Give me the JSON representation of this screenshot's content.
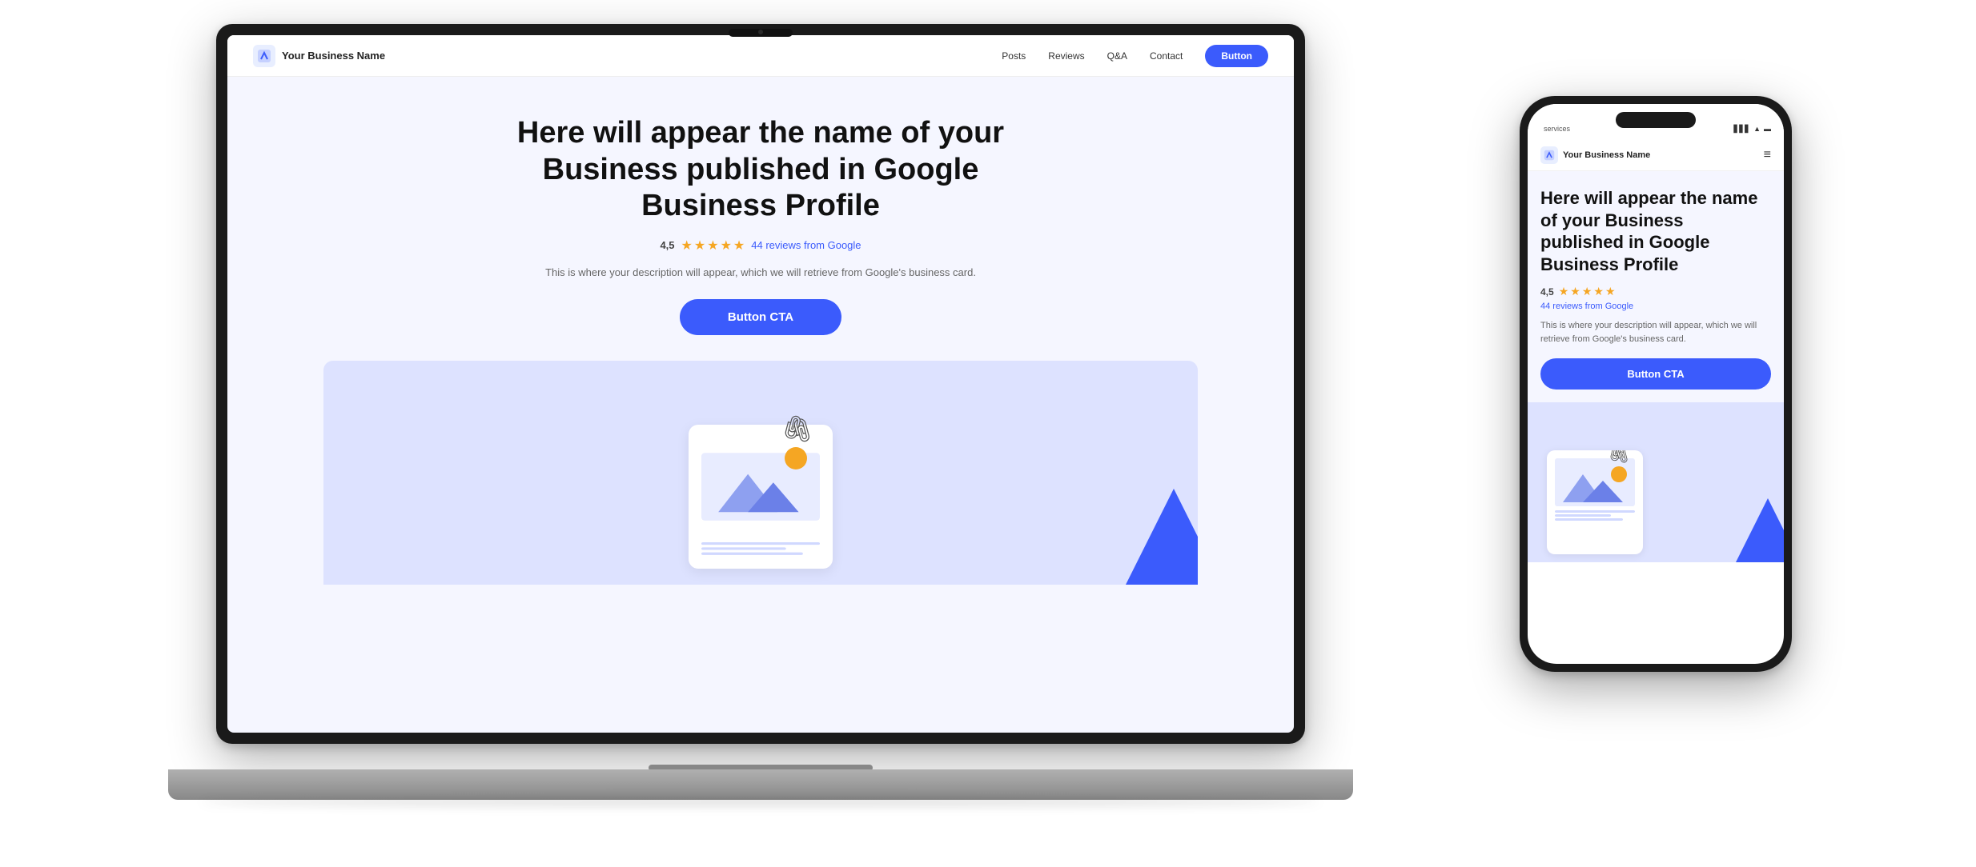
{
  "laptop": {
    "navbar": {
      "brand_name": "Your Business Name",
      "links": [
        "Posts",
        "Reviews",
        "Q&A",
        "Contact"
      ],
      "button_label": "Button"
    },
    "hero": {
      "title": "Here will appear the name of your Business published in Google Business Profile",
      "rating_number": "4,5",
      "stars_count": 5,
      "reviews_text": "44 reviews from Google",
      "description": "This is where your description will appear, which we will retrieve from Google's business card.",
      "cta_label": "Button CTA"
    }
  },
  "phone": {
    "status_bar": {
      "services_text": "services",
      "signal_icon": "signal-icon",
      "wifi_icon": "wifi-icon",
      "battery_icon": "battery-icon"
    },
    "navbar": {
      "brand_name": "Your Business Name",
      "menu_icon": "hamburger-icon"
    },
    "hero": {
      "title": "Here will appear the name of your Business published in Google Business Profile",
      "rating_number": "4,5",
      "stars_count": 5,
      "reviews_text": "44 reviews from Google",
      "description": "This is where your description will appear, which we will retrieve from Google's business card.",
      "cta_label": "Button CTA"
    }
  }
}
